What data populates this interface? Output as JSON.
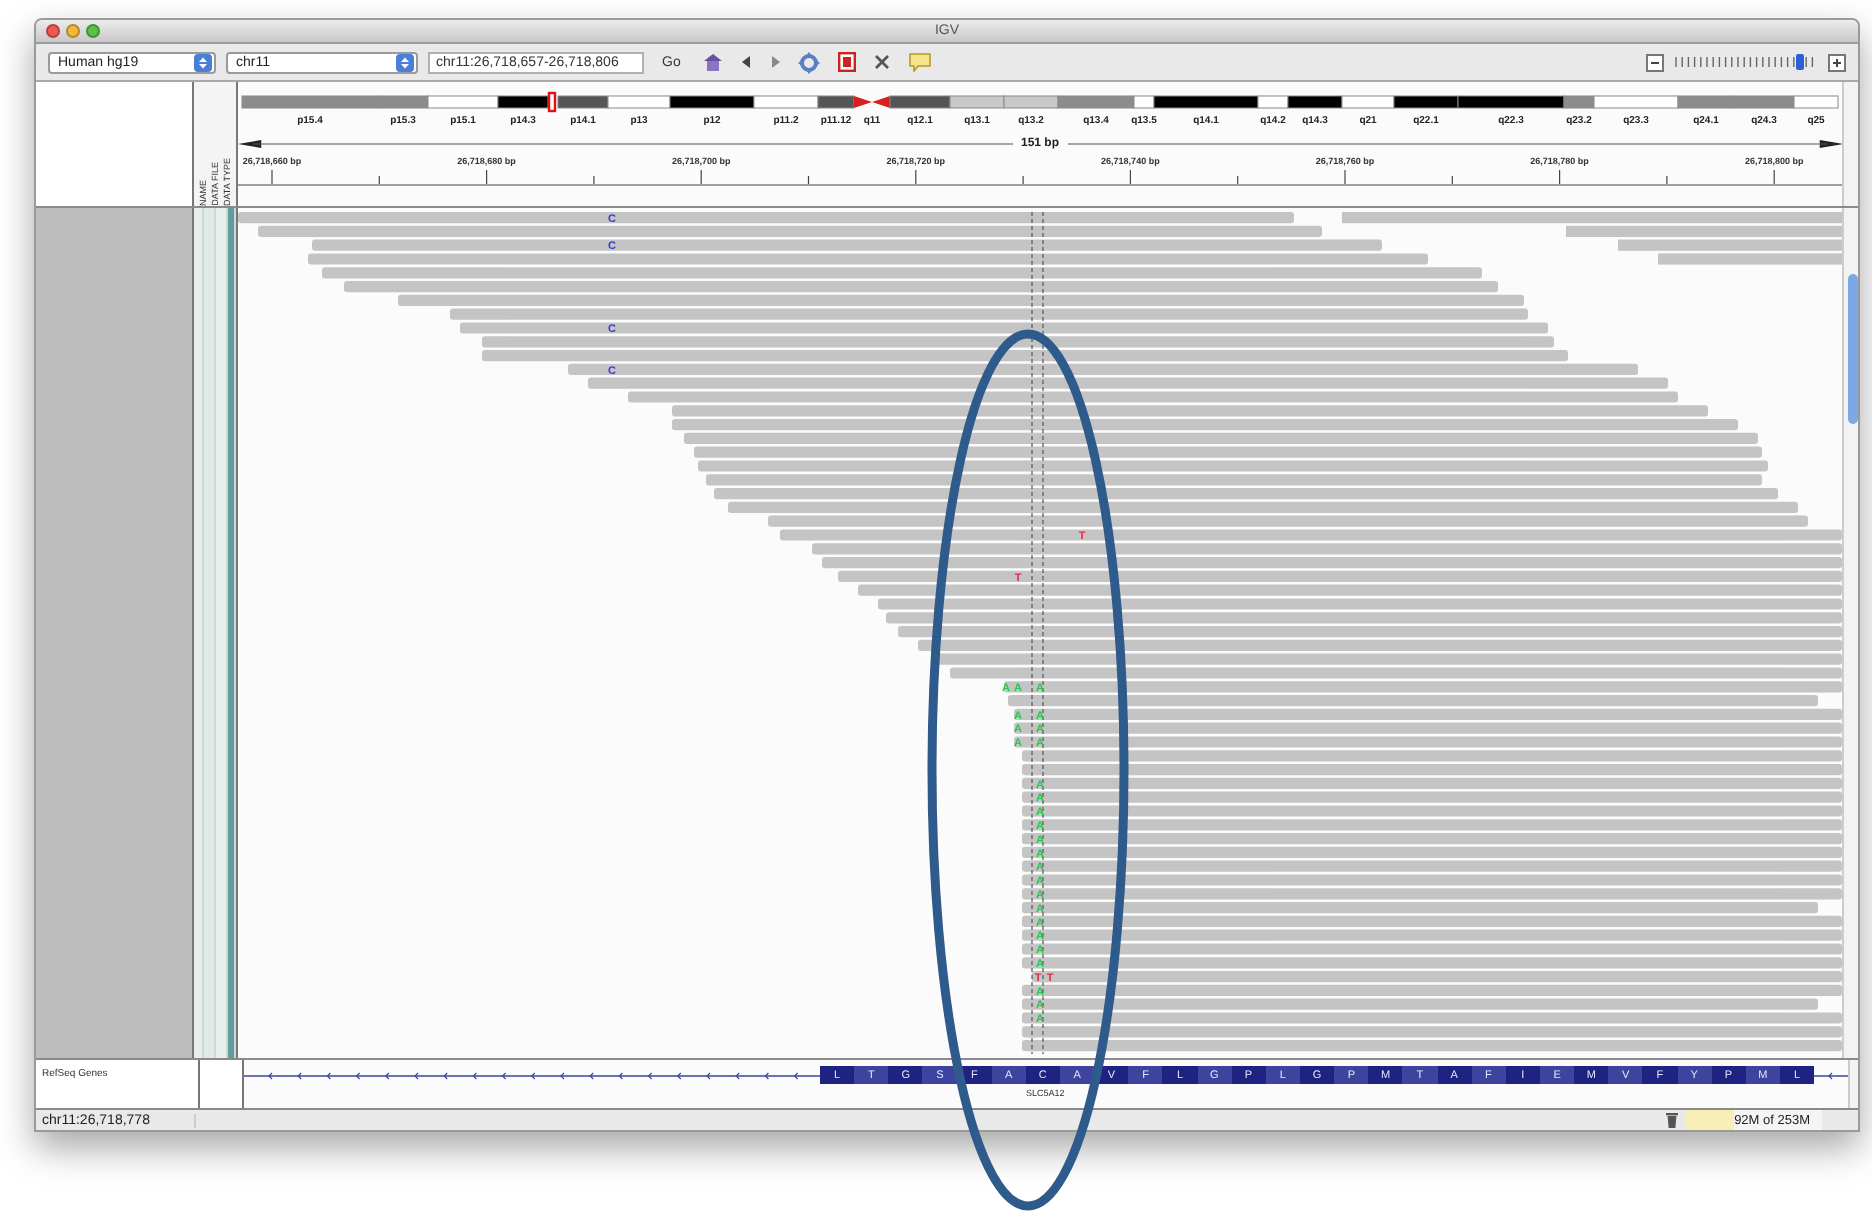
{
  "window": {
    "title": "IGV"
  },
  "toolbar": {
    "genome": "Human hg19",
    "chromosome": "chr11",
    "locus": "chr11:26,718,657-26,718,806",
    "go": "Go",
    "zoom": {
      "level": 0.88
    }
  },
  "ideogram": {
    "bands": [
      {
        "label": "p15.4",
        "color": "#8c8c8c",
        "current": false
      },
      {
        "label": "p15.3",
        "color": "#8c8c8c",
        "current": false
      },
      {
        "label": "p15.1",
        "color": "#ffffff",
        "current": false
      },
      {
        "label": "p14.3",
        "color": "#000000",
        "current": true
      },
      {
        "label": "p14.1",
        "color": "#555555",
        "current": false
      },
      {
        "label": "p13",
        "color": "#ffffff",
        "current": false
      },
      {
        "label": "p12",
        "color": "#000000",
        "current": false
      },
      {
        "label": "p11.2",
        "color": "#ffffff",
        "current": false
      },
      {
        "label": "p11.12",
        "color": "#555555",
        "current": false
      },
      {
        "label": "q11",
        "color": "#d42020",
        "current": false
      },
      {
        "label": "q12.1",
        "color": "#555555",
        "current": false
      },
      {
        "label": "q13.1",
        "color": "#c8c8c8",
        "current": false
      },
      {
        "label": "q13.2",
        "color": "#c8c8c8",
        "current": false
      },
      {
        "label": "q13.4",
        "color": "#8c8c8c",
        "current": false
      },
      {
        "label": "q13.5",
        "color": "#ffffff",
        "current": false
      },
      {
        "label": "q14.1",
        "color": "#000000",
        "current": false
      },
      {
        "label": "q14.2",
        "color": "#ffffff",
        "current": false
      },
      {
        "label": "q14.3",
        "color": "#000000",
        "current": false
      },
      {
        "label": "q21",
        "color": "#ffffff",
        "current": false
      },
      {
        "label": "q22.1",
        "color": "#000000",
        "current": false
      },
      {
        "label": "q22.3",
        "color": "#000000",
        "current": false
      },
      {
        "label": "q23.2",
        "color": "#8c8c8c",
        "current": false
      },
      {
        "label": "q23.3",
        "color": "#ffffff",
        "current": false
      },
      {
        "label": "q24.1",
        "color": "#8c8c8c",
        "current": false
      },
      {
        "label": "q24.3",
        "color": "#8c8c8c",
        "current": false
      },
      {
        "label": "q25",
        "color": "#ffffff",
        "current": false
      }
    ]
  },
  "ruler": {
    "span": "151 bp",
    "ticks": [
      "26,718,660 bp",
      "26,718,680 bp",
      "26,718,700 bp",
      "26,718,720 bp",
      "26,718,740 bp",
      "26,718,760 bp",
      "26,718,780 bp",
      "26,718,800 bp"
    ]
  },
  "attribute_headers": [
    "NAME",
    "DATA FILE",
    "DATA TYPE"
  ],
  "alignment": {
    "mismatches": [
      {
        "base": "C",
        "color": "#3b3bd0"
      },
      {
        "base": "C",
        "color": "#3b3bd0"
      },
      {
        "base": "C",
        "color": "#3b3bd0"
      },
      {
        "base": "C",
        "color": "#3b3bd0"
      },
      {
        "base": "T",
        "color": "#e0304a"
      },
      {
        "base": "T",
        "color": "#e0304a"
      },
      {
        "base": "A",
        "color": "#22c84a"
      },
      {
        "base": "A",
        "color": "#22c84a"
      },
      {
        "base": "A",
        "color": "#22c84a"
      },
      {
        "base": "A",
        "color": "#22c84a"
      },
      {
        "base": "A",
        "color": "#22c84a"
      },
      {
        "base": "A",
        "color": "#22c84a"
      },
      {
        "base": "A",
        "color": "#22c84a"
      },
      {
        "base": "A",
        "color": "#22c84a"
      },
      {
        "base": "A",
        "color": "#22c84a"
      },
      {
        "base": "A",
        "color": "#22c84a"
      },
      {
        "base": "A",
        "color": "#22c84a"
      },
      {
        "base": "A",
        "color": "#22c84a"
      },
      {
        "base": "A",
        "color": "#22c84a"
      },
      {
        "base": "A",
        "color": "#22c84a"
      },
      {
        "base": "A",
        "color": "#22c84a"
      },
      {
        "base": "A",
        "color": "#22c84a"
      },
      {
        "base": "A",
        "color": "#22c84a"
      },
      {
        "base": "A",
        "color": "#22c84a"
      },
      {
        "base": "A",
        "color": "#22c84a"
      },
      {
        "base": "A",
        "color": "#22c84a"
      },
      {
        "base": "A",
        "color": "#22c84a"
      },
      {
        "base": "A",
        "color": "#22c84a"
      },
      {
        "base": "A",
        "color": "#22c84a"
      },
      {
        "base": "T",
        "color": "#e0304a"
      },
      {
        "base": "T",
        "color": "#e0304a"
      },
      {
        "base": "A",
        "color": "#22c84a"
      },
      {
        "base": "A",
        "color": "#22c84a"
      },
      {
        "base": "A",
        "color": "#22c84a"
      }
    ]
  },
  "gene_track": {
    "name": "RefSeq Genes",
    "gene": "SLC5A12",
    "amino_acids": [
      "L",
      "T",
      "G",
      "S",
      "F",
      "A",
      "C",
      "A",
      "V",
      "F",
      "L",
      "G",
      "P",
      "L",
      "G",
      "P",
      "M",
      "T",
      "A",
      "F",
      "I",
      "E",
      "M",
      "V",
      "F",
      "Y",
      "P",
      "M",
      "L"
    ]
  },
  "status_bar": {
    "locus": "chr11:26,718,778",
    "memory": {
      "text": "92M of 253M",
      "level": 0.36
    }
  }
}
